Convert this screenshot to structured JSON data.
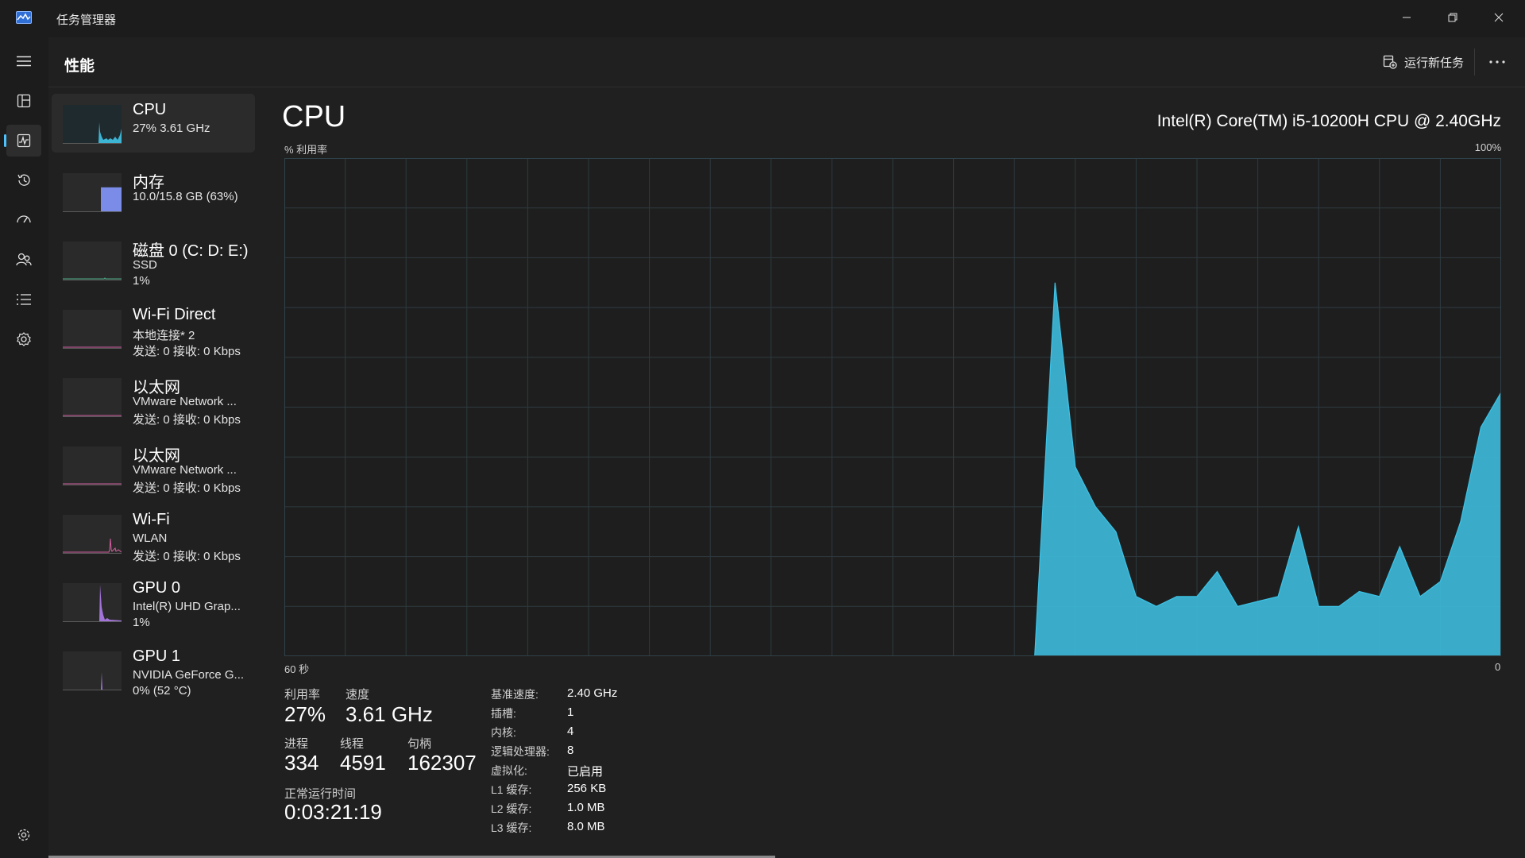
{
  "window": {
    "title": "任务管理器"
  },
  "header": {
    "page_title": "性能",
    "run_task_label": "运行新任务"
  },
  "nav_icons": [
    "menu-icon",
    "processes-icon",
    "performance-icon",
    "app-history-icon",
    "startup-icon",
    "users-icon",
    "details-icon",
    "services-icon",
    "settings-icon"
  ],
  "devices": [
    {
      "name": "CPU",
      "line1": "27% 3.61 GHz",
      "line2": "",
      "color": "#3cb4d4"
    },
    {
      "name": "内存",
      "line1": "10.0/15.8 GB (63%)",
      "line2": "",
      "color": "#7b8ce8",
      "level": 0.63
    },
    {
      "name": "磁盘 0 (C: D: E:)",
      "line1": "SSD",
      "line2": "1%",
      "color": "#4caf88"
    },
    {
      "name": "Wi-Fi Direct",
      "line1": "本地连接* 2",
      "line2": "发送: 0 接收: 0 Kbps",
      "color": "#d35fa0"
    },
    {
      "name": "以太网",
      "line1": "VMware Network ...",
      "line2": "发送: 0 接收: 0 Kbps",
      "color": "#d35fa0"
    },
    {
      "name": "以太网",
      "line1": "VMware Network ...",
      "line2": "发送: 0 接收: 0 Kbps",
      "color": "#d35fa0"
    },
    {
      "name": "Wi-Fi",
      "line1": "WLAN",
      "line2": "发送: 0 接收: 0 Kbps",
      "color": "#d35fa0"
    },
    {
      "name": "GPU 0",
      "line1": "Intel(R) UHD Grap...",
      "line2": "1%",
      "color": "#a273d8"
    },
    {
      "name": "GPU 1",
      "line1": "NVIDIA GeForce G...",
      "line2": "0% (52 °C)",
      "color": "#a273d8"
    }
  ],
  "main": {
    "title": "CPU",
    "model": "Intel(R) Core(TM) i5-10200H CPU @ 2.40GHz",
    "util_label": "% 利用率",
    "util_max": "100%",
    "x_left": "60 秒",
    "x_right": "0"
  },
  "chart_data": {
    "type": "area",
    "title": "",
    "ylabel": "% 利用率",
    "xlabel": "",
    "x_range_seconds": [
      60,
      0
    ],
    "ylim": [
      0,
      100
    ],
    "grid": true,
    "color": "#3cb4d4",
    "x": [
      60,
      59,
      58,
      57,
      56,
      55,
      54,
      53,
      52,
      51,
      50,
      49,
      48,
      47,
      46,
      45,
      44,
      43,
      42,
      41,
      40,
      39,
      38,
      37,
      36,
      35,
      34,
      33,
      32,
      31,
      30,
      29,
      28,
      27,
      26,
      25,
      24,
      23,
      22,
      21,
      20,
      19,
      18,
      17,
      16,
      15,
      14,
      13,
      12,
      11,
      10,
      9,
      8,
      7,
      6,
      5,
      4,
      3,
      2,
      1,
      0
    ],
    "values": [
      0,
      0,
      0,
      0,
      0,
      0,
      0,
      0,
      0,
      0,
      0,
      0,
      0,
      0,
      0,
      0,
      0,
      0,
      0,
      0,
      0,
      0,
      0,
      0,
      0,
      0,
      0,
      0,
      0,
      0,
      0,
      0,
      0,
      0,
      0,
      0,
      0,
      0,
      0,
      0,
      0,
      0,
      0,
      0,
      0,
      0,
      0,
      0,
      0,
      0,
      0,
      0,
      0,
      0,
      0,
      0,
      0,
      0,
      0,
      0,
      0
    ],
    "series": [
      {
        "values": [
          0,
          0,
          0,
          0,
          0,
          0,
          0,
          0,
          0,
          0,
          0,
          0,
          0,
          0,
          0,
          0,
          0,
          0,
          0,
          0,
          0,
          0,
          0,
          0,
          0,
          0,
          0,
          0,
          0,
          0,
          0,
          0,
          0,
          0,
          0,
          0,
          0,
          0,
          75,
          38,
          30,
          25,
          12,
          10,
          12,
          12,
          17,
          10,
          11,
          12,
          26,
          10,
          10,
          13,
          12,
          22,
          12,
          15,
          27,
          46,
          53
        ]
      }
    ]
  },
  "stats": {
    "util_label": "利用率",
    "util_value": "27%",
    "speed_label": "速度",
    "speed_value": "3.61 GHz",
    "proc_label": "进程",
    "proc_value": "334",
    "thread_label": "线程",
    "thread_value": "4591",
    "handle_label": "句柄",
    "handle_value": "162307",
    "uptime_label": "正常运行时间",
    "uptime_value": "0:03:21:19"
  },
  "info": [
    {
      "k": "基准速度:",
      "v": "2.40 GHz"
    },
    {
      "k": "插槽:",
      "v": "1"
    },
    {
      "k": "内核:",
      "v": "4"
    },
    {
      "k": "逻辑处理器:",
      "v": "8"
    },
    {
      "k": "虚拟化:",
      "v": "已启用"
    },
    {
      "k": "L1 缓存:",
      "v": "256 KB"
    },
    {
      "k": "L2 缓存:",
      "v": "1.0 MB"
    },
    {
      "k": "L3 缓存:",
      "v": "8.0 MB"
    }
  ]
}
